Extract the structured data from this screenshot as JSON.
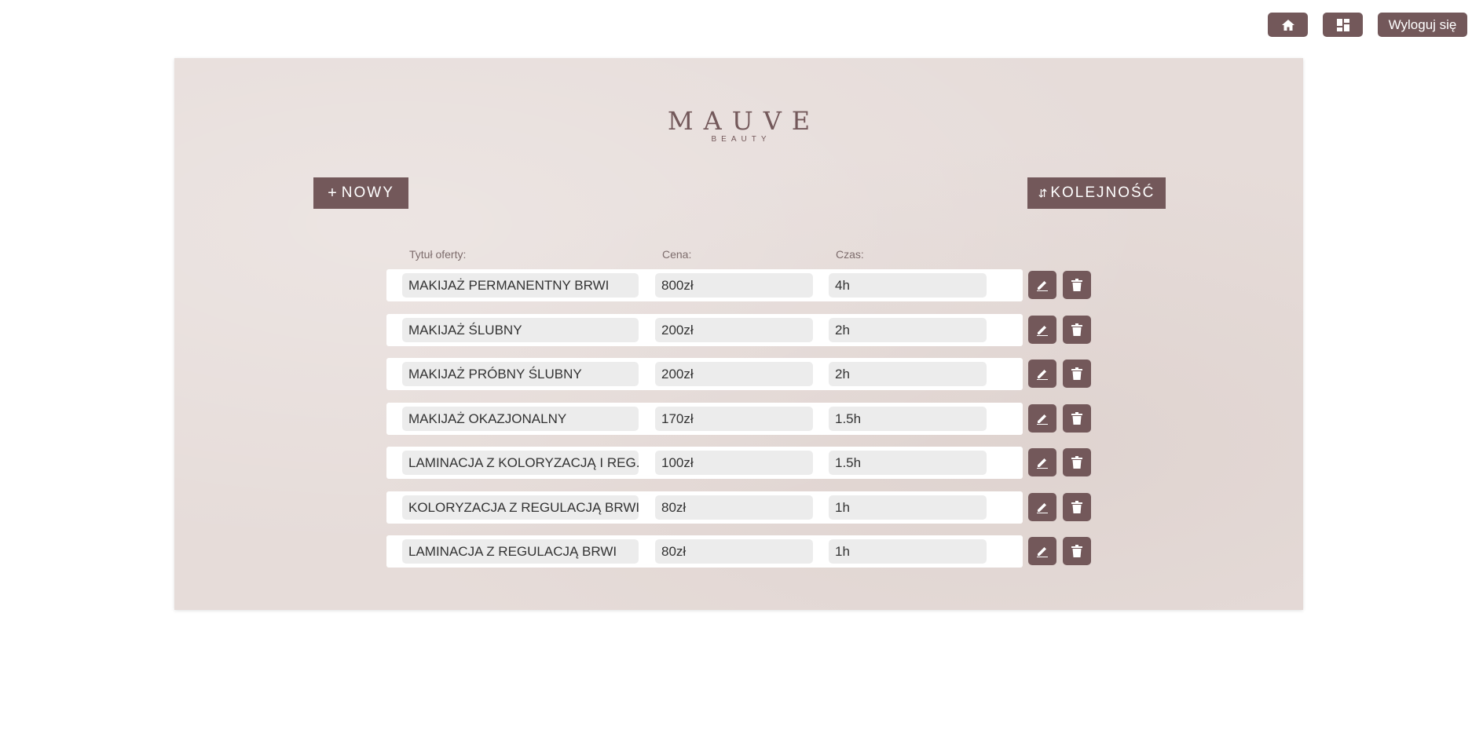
{
  "nav": {
    "home_icon": "home-icon",
    "dashboard_icon": "dashboard-icon",
    "logout_label": "Wyloguj się"
  },
  "logo": {
    "main": "MAUVE",
    "sub": "BEAUTY"
  },
  "toolbar": {
    "new_label": "NOWY",
    "new_icon": "+",
    "order_label": "KOLEJNOŚĆ",
    "order_icon": "⇵"
  },
  "table": {
    "headers": {
      "title": "Tytuł oferty:",
      "price": "Cena:",
      "time": "Czas:"
    },
    "rows": [
      {
        "title": "MAKIJAŻ PERMANENTNY BRWI",
        "price": "800zł",
        "time": "4h"
      },
      {
        "title": "MAKIJAŻ ŚLUBNY",
        "price": "200zł",
        "time": "2h"
      },
      {
        "title": "MAKIJAŻ PRÓBNY ŚLUBNY",
        "price": "200zł",
        "time": "2h"
      },
      {
        "title": "MAKIJAŻ OKAZJONALNY",
        "price": "170zł",
        "time": "1.5h"
      },
      {
        "title": "LAMINACJA Z KOLORYZACJĄ I REG...",
        "price": "100zł",
        "time": "1.5h"
      },
      {
        "title": "KOLORYZACJA Z REGULACJĄ BRWI",
        "price": "80zł",
        "time": "1h"
      },
      {
        "title": "LAMINACJA Z REGULACJĄ BRWI",
        "price": "80zł",
        "time": "1h"
      }
    ]
  },
  "colors": {
    "accent": "#73585a",
    "panel": "#e6dcd9",
    "field": "#ececec"
  }
}
